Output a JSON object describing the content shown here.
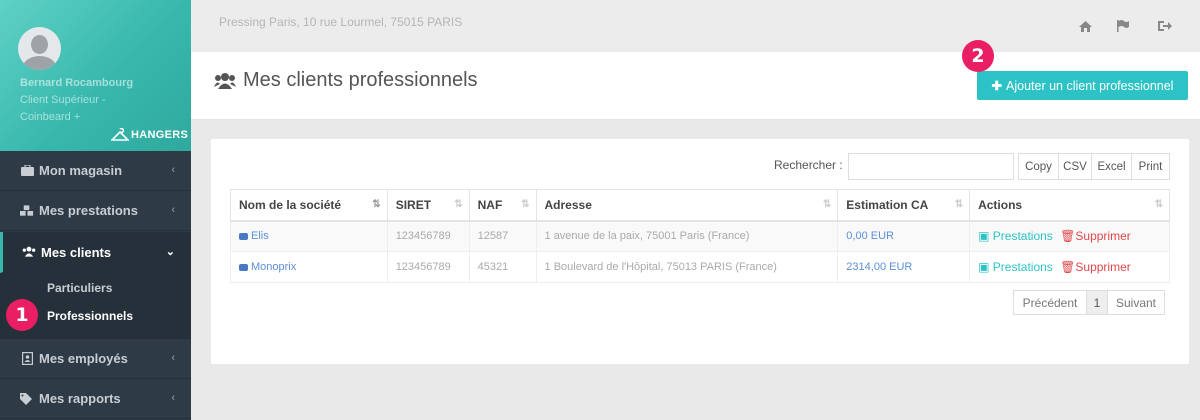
{
  "profile": {
    "name": "Bernard Rocambourg",
    "role": "Client Supérieur -",
    "shop": "Coinbeard +"
  },
  "brand": {
    "logo_text": "HANGERS",
    "accent": "#2dc3c6",
    "badge_color": "#e91e63"
  },
  "sidebar": {
    "items": [
      {
        "label": "Mon magasin",
        "icon": "briefcase-icon"
      },
      {
        "label": "Mes prestations",
        "icon": "cubes-icon"
      },
      {
        "label": "Mes clients",
        "icon": "users-icon"
      },
      {
        "label": "Mes employés",
        "icon": "id-card-icon"
      },
      {
        "label": "Mes rapports",
        "icon": "tags-icon"
      }
    ],
    "sub_items": [
      "Particuliers",
      "Professionnels"
    ]
  },
  "badges": [
    "1",
    "2"
  ],
  "topbar": {
    "address": "Pressing Paris, 10 rue Lourmel, 75015 PARIS"
  },
  "header": {
    "title": "Mes clients professionnels",
    "add_button": "Ajouter un client professionnel"
  },
  "table": {
    "search_label": "Rechercher :",
    "search_value": "",
    "export_buttons": [
      "Copy",
      "CSV",
      "Excel",
      "Print"
    ],
    "columns": [
      "Nom de la société",
      "SIRET",
      "NAF",
      "Adresse",
      "Estimation CA",
      "Actions"
    ],
    "rows": [
      {
        "company": "Elis",
        "siret": "123456789",
        "naf": "12587",
        "address": "1 avenue de la paix, 75001 Paris (France)",
        "ca": "0,00 EUR",
        "action_prestations": "Prestations",
        "action_delete": "Supprimer"
      },
      {
        "company": "Monoprix",
        "siret": "123456789",
        "naf": "45321",
        "address": "1 Boulevard de l'Hôpital, 75013 PARIS (France)",
        "ca": "2314,00 EUR",
        "action_prestations": "Prestations",
        "action_delete": "Supprimer"
      }
    ],
    "pagination": {
      "prev": "Précédent",
      "current": "1",
      "next": "Suivant"
    }
  }
}
